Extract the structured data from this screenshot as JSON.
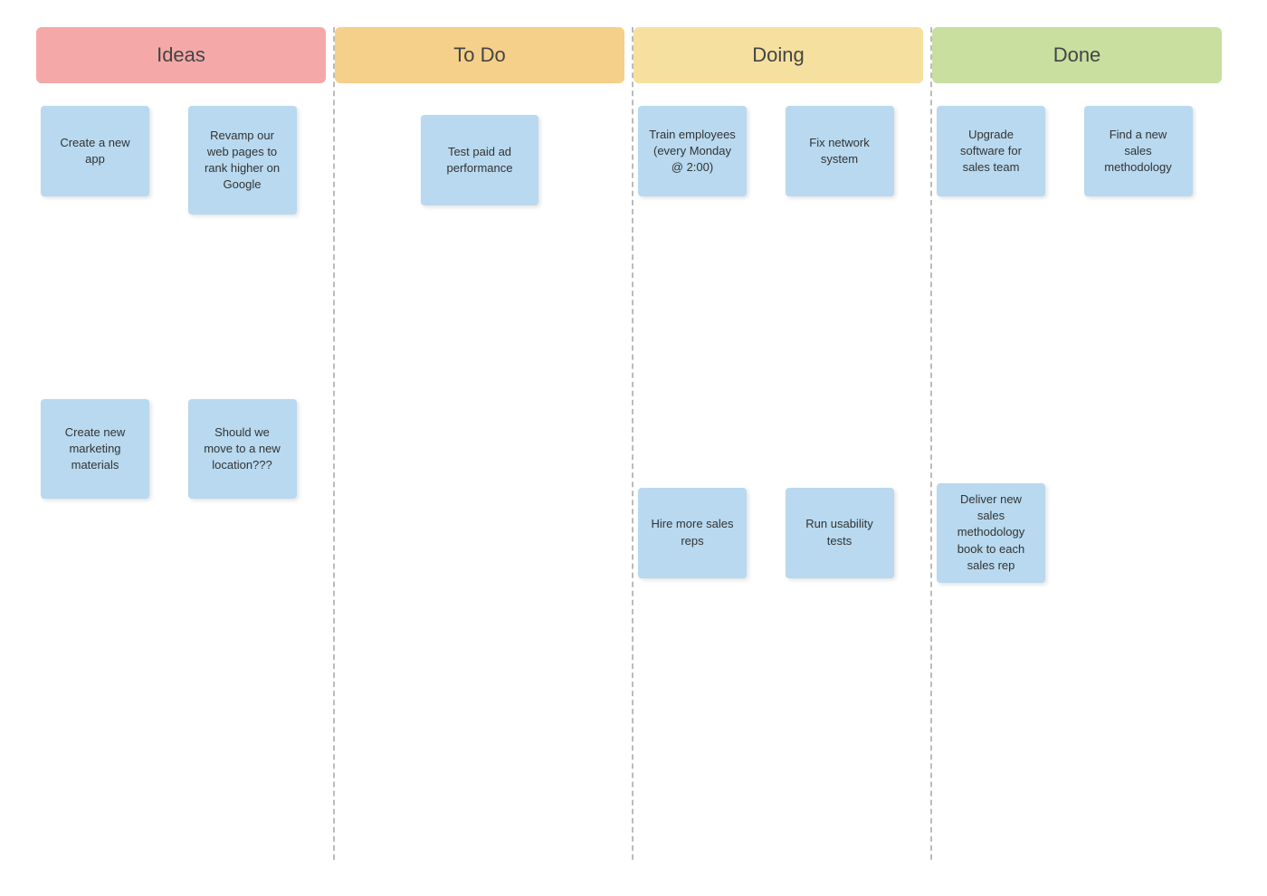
{
  "columns": [
    {
      "id": "ideas",
      "label": "Ideas",
      "cards": [
        {
          "id": "idea-1",
          "text": "Create a new app"
        },
        {
          "id": "idea-2",
          "text": "Revamp our web pages to rank higher on Google"
        },
        {
          "id": "idea-3",
          "text": "Create new marketing materials"
        },
        {
          "id": "idea-4",
          "text": "Should we move to a new location???"
        }
      ]
    },
    {
      "id": "todo",
      "label": "To Do",
      "cards": [
        {
          "id": "todo-1",
          "text": "Test paid ad performance"
        }
      ]
    },
    {
      "id": "doing",
      "label": "Doing",
      "cards": [
        {
          "id": "doing-1",
          "text": "Train employees (every Monday @ 2:00)"
        },
        {
          "id": "doing-2",
          "text": "Fix network system"
        },
        {
          "id": "doing-3",
          "text": "Hire more sales reps"
        },
        {
          "id": "doing-4",
          "text": "Run usability tests"
        }
      ]
    },
    {
      "id": "done",
      "label": "Done",
      "cards": [
        {
          "id": "done-1",
          "text": "Upgrade software for sales team"
        },
        {
          "id": "done-2",
          "text": "Find a new sales methodology"
        },
        {
          "id": "done-3",
          "text": "Deliver new sales methodology book to each sales rep"
        }
      ]
    }
  ]
}
